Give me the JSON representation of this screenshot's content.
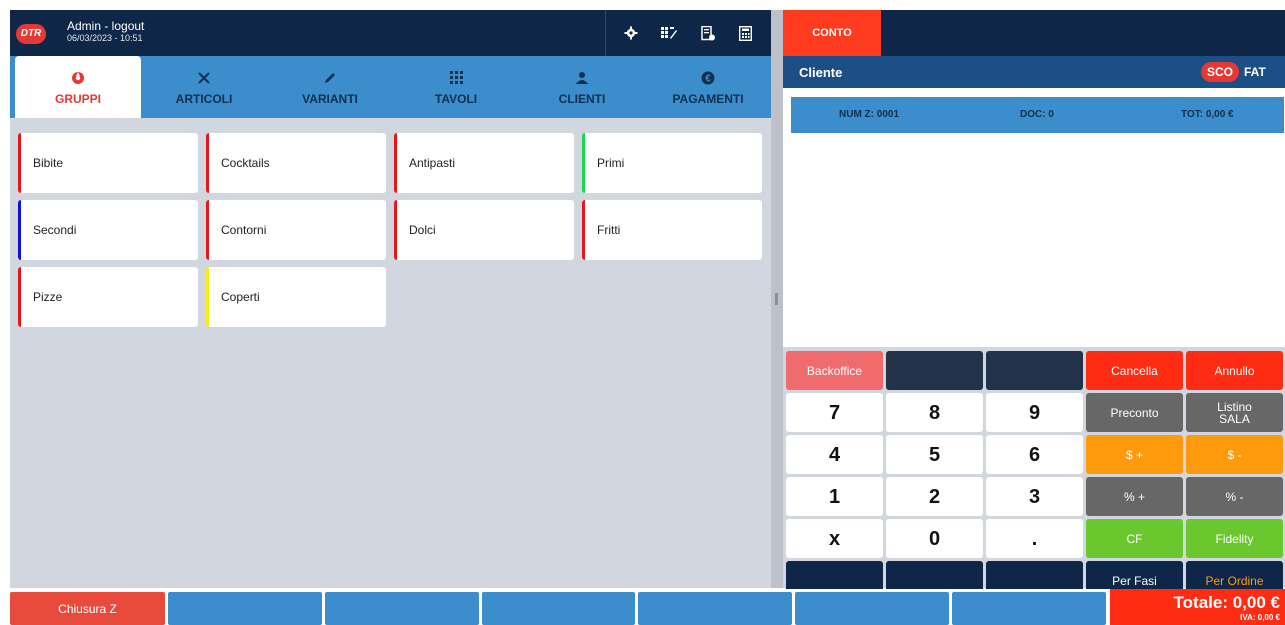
{
  "header": {
    "logo_text": "DTR",
    "user": "Admin - logout",
    "datetime": "06/03/2023 - 10:51",
    "icons": [
      "gear-icon",
      "qr-grid-icon",
      "receipt-icon",
      "calculator-icon"
    ]
  },
  "tabs": [
    {
      "label": "GRUPPI",
      "icon": "groups-icon",
      "active": true
    },
    {
      "label": "ARTICOLI",
      "icon": "cutlery-icon",
      "active": false
    },
    {
      "label": "VARIANTI",
      "icon": "pencil-icon",
      "active": false
    },
    {
      "label": "TAVOLI",
      "icon": "grid-icon",
      "active": false
    },
    {
      "label": "CLIENTI",
      "icon": "user-icon",
      "active": false
    },
    {
      "label": "PAGAMENTI",
      "icon": "euro-icon",
      "active": false
    }
  ],
  "groups": [
    {
      "label": "Bibite",
      "color": "#e8151b"
    },
    {
      "label": "Cocktails",
      "color": "#e8151b"
    },
    {
      "label": "Antipasti",
      "color": "#e8151b"
    },
    {
      "label": "Primi",
      "color": "#19d94b"
    },
    {
      "label": "Secondi",
      "color": "#1010d8"
    },
    {
      "label": "Contorni",
      "color": "#e8151b"
    },
    {
      "label": "Dolci",
      "color": "#e8151b"
    },
    {
      "label": "Fritti",
      "color": "#e8151b"
    },
    {
      "label": "Pizze",
      "color": "#e8151b"
    },
    {
      "label": "Coperti",
      "color": "#f7f00f"
    }
  ],
  "right": {
    "conto_tab": "CONTO",
    "client_label": "Cliente",
    "sco": "SCO",
    "fat": "FAT",
    "num_z": "NUM Z: 0001",
    "doc": "DOC: 0",
    "tot": "TOT: 0,00 €"
  },
  "keypad": [
    "Backoffice",
    "",
    "",
    "Cancella",
    "Annullo",
    "7",
    "8",
    "9",
    "Preconto",
    "Listino SALA",
    "4",
    "5",
    "6",
    "$ +",
    "$ -",
    "1",
    "2",
    "3",
    "% +",
    "% -",
    "x",
    "0",
    ".",
    "CF",
    "Fidelity",
    "",
    "",
    "",
    "Per Fasi",
    "Per Ordine"
  ],
  "bottom": {
    "chiusura": "Chiusura Z",
    "total": "Totale: 0,00 €",
    "iva": "IVA: 0,00 €"
  }
}
